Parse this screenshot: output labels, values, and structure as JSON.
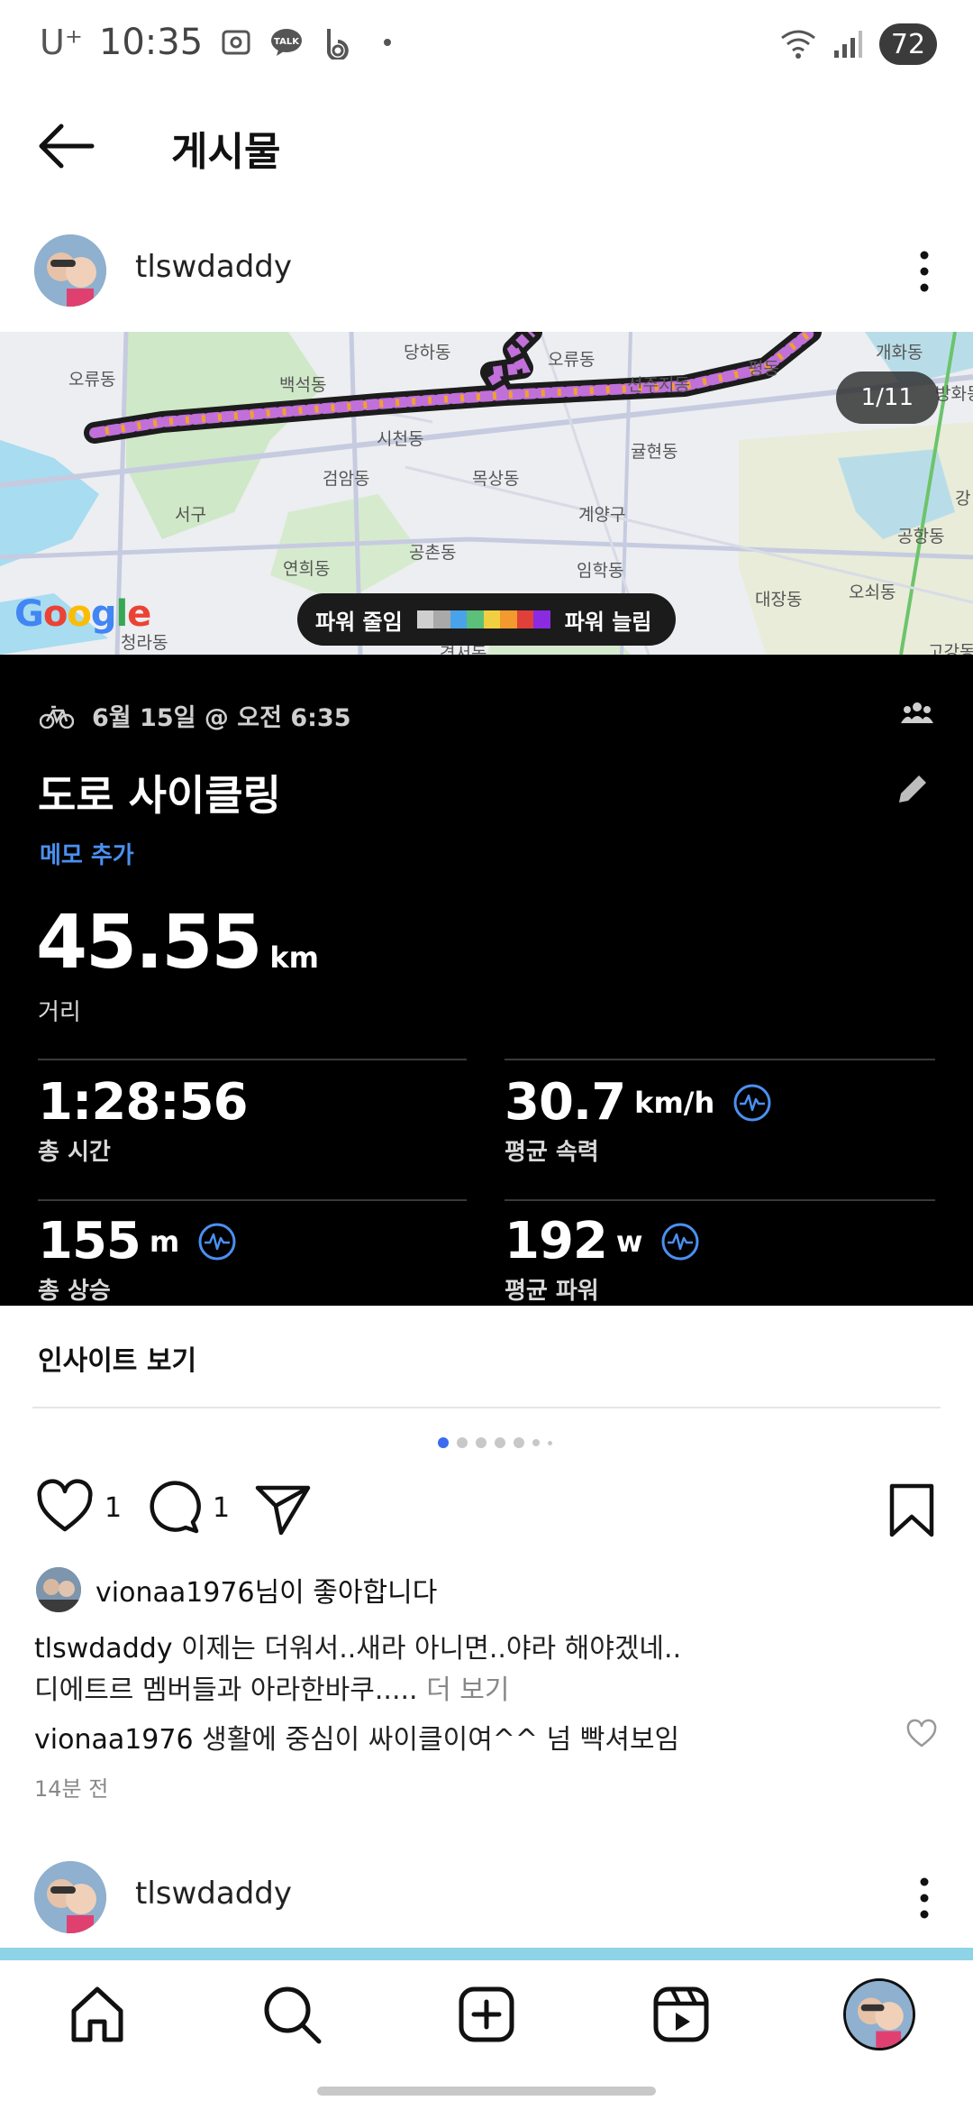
{
  "status_bar": {
    "carrier": "U⁺",
    "time": "10:35",
    "battery": "72"
  },
  "header": {
    "title": "게시물"
  },
  "post": {
    "author": "tlswdaddy",
    "page_counter": "1/11",
    "map": {
      "labels": [
        "당하동",
        "오류동",
        "오류동",
        "백석동",
        "선주지동",
        "개화동",
        "평동",
        "방화동",
        "시천동",
        "검암동",
        "목상동",
        "귤현동",
        "서구",
        "계양구",
        "공촌동",
        "공항동",
        "강",
        "연희동",
        "임학동",
        "오쇠동",
        "대장동",
        "청라동",
        "고강동",
        "경서동"
      ],
      "google_logo": "Google",
      "legend_left": "파워 줄임",
      "legend_right": "파워 늘림",
      "legend_colors": [
        "#cfcfcf",
        "#a9a9a9",
        "#4aa3e8",
        "#5cc07a",
        "#f0d040",
        "#f39a2e",
        "#e0403a",
        "#8a2be2"
      ]
    },
    "activity": {
      "date": "6월 15일 @ 오전 6:35",
      "title": "도로 사이클링",
      "memo_link": "메모 추가",
      "distance_value": "45.55",
      "distance_unit": "km",
      "distance_label": "거리",
      "stats": [
        {
          "value": "1:28:56",
          "unit": "",
          "label": "총 시간"
        },
        {
          "value": "30.7",
          "unit": "km/h",
          "label": "평균 속력"
        },
        {
          "value": "155",
          "unit": "m",
          "label": "총 상승"
        },
        {
          "value": "192",
          "unit": "w",
          "label": "평균 파워"
        }
      ]
    },
    "insight_label": "인사이트 보기",
    "like_count": "1",
    "comment_count": "1",
    "liked_by": "vionaa1976님이 좋아합니다",
    "caption_author": "tlswdaddy",
    "caption_text": "이제는 더워서..새라 아니면..야라 해야겠네..",
    "caption_line2": "디에트르 멤버들과 아라한바쿠.....",
    "caption_more": "더 보기",
    "comment_author": "vionaa1976",
    "comment_text": "생활에 중심이 싸이클이여^^ 넘 빡셔보임",
    "timestamp": "14분 전"
  },
  "next_post": {
    "author": "tlswdaddy"
  }
}
